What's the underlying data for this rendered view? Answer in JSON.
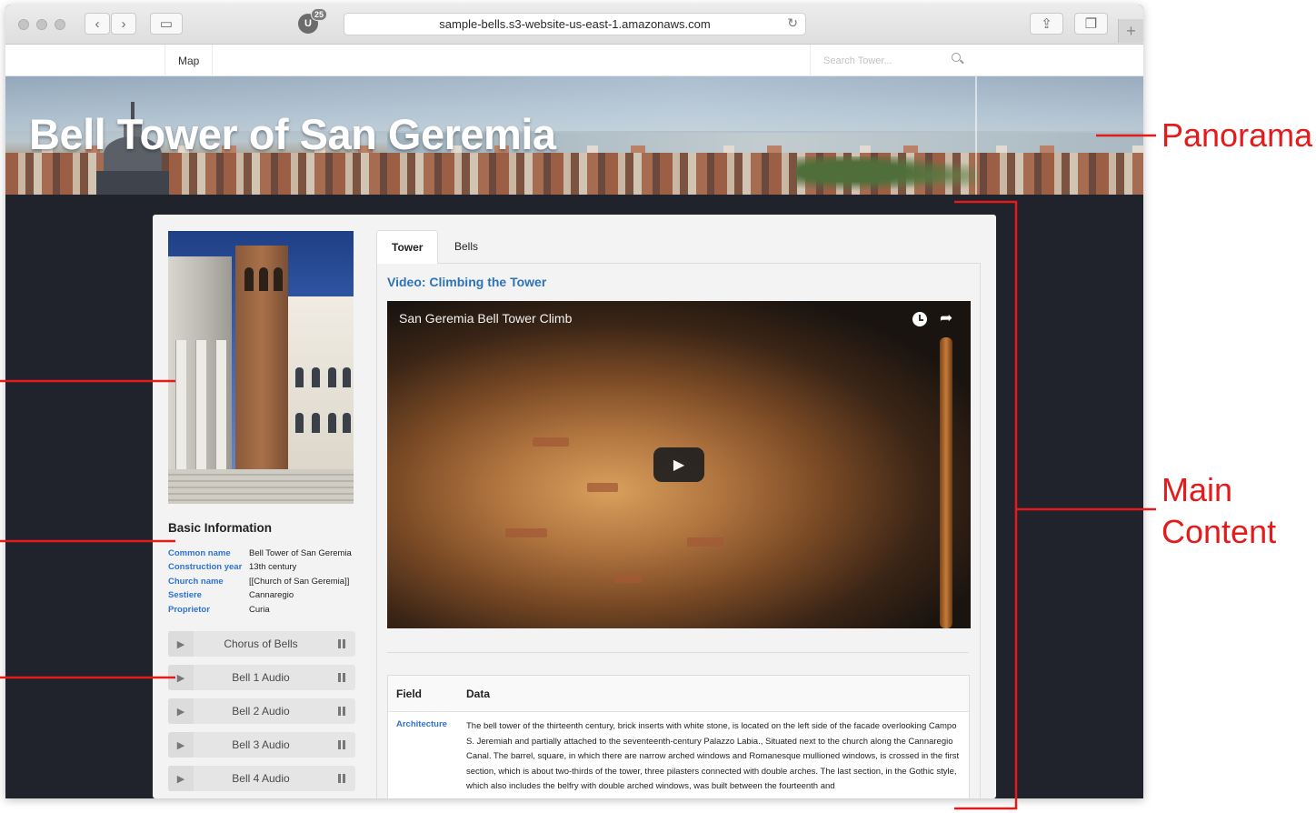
{
  "browser": {
    "extension_badge": "U",
    "extension_count": "25",
    "url": "sample-bells.s3-website-us-east-1.amazonaws.com",
    "icons": [
      "back-icon",
      "forward-icon",
      "sidebar-icon",
      "reload-icon",
      "share-icon",
      "tabs-icon",
      "new-tab-icon"
    ],
    "new_tab_label": "+"
  },
  "site_nav": {
    "items": [
      {
        "label": "Map"
      }
    ],
    "search_placeholder": "Search Tower..."
  },
  "hero": {
    "title": "Bell Tower of San Geremia"
  },
  "sidebar": {
    "basic_info_title": "Basic Information",
    "info": [
      {
        "key": "Common name",
        "value": "Bell Tower of San Geremia"
      },
      {
        "key": "Construction year",
        "value": "13th century"
      },
      {
        "key": "Church name",
        "value": "[[Church of San Geremia]]"
      },
      {
        "key": "Sestiere",
        "value": "Cannaregio"
      },
      {
        "key": "Proprietor",
        "value": "Curia"
      }
    ],
    "players": [
      {
        "label": "Chorus of Bells"
      },
      {
        "label": "Bell 1 Audio"
      },
      {
        "label": "Bell 2 Audio"
      },
      {
        "label": "Bell 3 Audio"
      },
      {
        "label": "Bell 4 Audio"
      }
    ]
  },
  "tabs": [
    {
      "label": "Tower",
      "active": true
    },
    {
      "label": "Bells",
      "active": false
    }
  ],
  "main": {
    "video_heading": "Video: Climbing the Tower",
    "video_title": "San Geremia Bell Tower Climb",
    "table_headers": [
      "Field",
      "Data"
    ],
    "rows": [
      {
        "field": "Architecture",
        "data": "The bell tower of the thirteenth century, brick inserts with white stone, is located on the left side of the facade overlooking Campo S. Jeremiah and partially attached to the seventeenth-century Palazzo Labia., Situated next to the church along the Cannaregio Canal. The barrel, square, in which there are narrow arched windows and Romanesque mullioned windows, is crossed in the first section, which is about two-thirds of the tower, three pilasters connected with double arches. The last section, in the Gothic style, which also includes the belfry with double arched windows, was built between the fourteenth and"
      }
    ]
  },
  "annotations": {
    "panorama": "Panorama",
    "main_content_line1": "Main",
    "main_content_line2": "Content"
  },
  "colors": {
    "accent_link": "#2f73d4",
    "annotation_red": "#e31b1b",
    "page_dark": "#20232b"
  }
}
